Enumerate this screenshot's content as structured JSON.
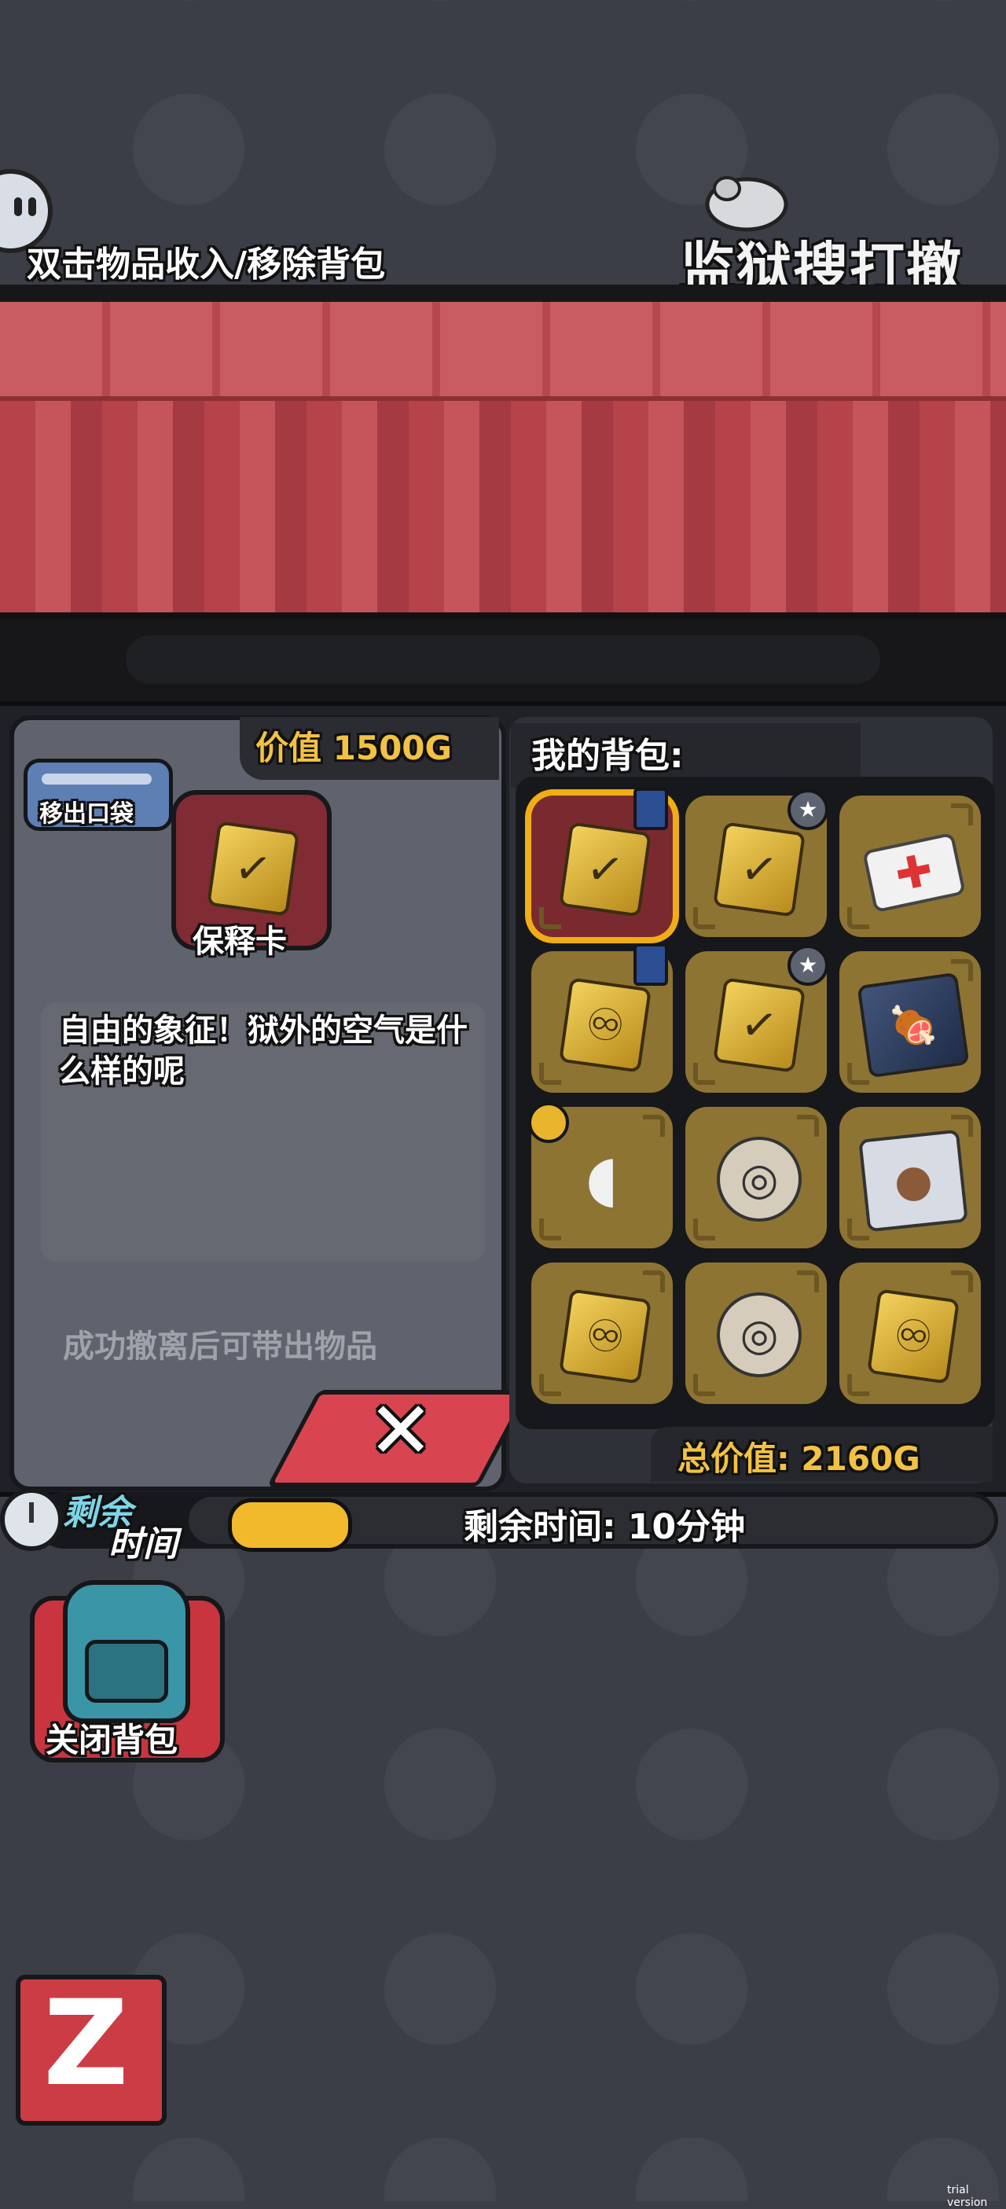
{
  "header": {
    "hint": "双击物品收入/移除背包",
    "logo_text": "监狱搜打撤"
  },
  "detail": {
    "value_label": "价值 1500G",
    "remove_pocket_label": "移出口袋",
    "item_name": "保释卡",
    "description": "自由的象征！狱外的空气是什么样的呢",
    "carry_note": "成功撤离后可带出物品"
  },
  "bag": {
    "title": "我的背包:",
    "total": "总价值: 2160G",
    "slots": [
      {
        "icon": "bail-card-icon",
        "glyph": "✓",
        "selected": true,
        "badge": "pants-icon"
      },
      {
        "icon": "bail-card-icon",
        "glyph": "✓",
        "badge": "star-icon"
      },
      {
        "icon": "medical-card-icon",
        "glyph": "✚"
      },
      {
        "icon": "gold-ribbon-card-icon",
        "glyph": "♾",
        "badge": "pants-icon"
      },
      {
        "icon": "bail-card-icon",
        "glyph": "✓",
        "badge": "star-icon"
      },
      {
        "icon": "steak-package-icon",
        "glyph": "🍖"
      },
      {
        "icon": "earbud-icon",
        "glyph": "◖",
        "badge": "coin-icon"
      },
      {
        "icon": "film-reel-icon",
        "glyph": "◎"
      },
      {
        "icon": "capybara-pack-icon",
        "glyph": "●"
      },
      {
        "icon": "gold-ribbon-card-icon",
        "glyph": "♾"
      },
      {
        "icon": "film-reel-icon",
        "glyph": "◎"
      },
      {
        "icon": "gold-ribbon-card-icon",
        "glyph": "♾"
      }
    ]
  },
  "timer": {
    "label_1": "剩余",
    "label_2": "时间",
    "text": "剩余时间: 10分钟",
    "fill_fraction": 0.15
  },
  "actions": {
    "close_bag": "关闭背包",
    "close_x": "✕",
    "z_button": "Z"
  },
  "footer": {
    "trial": "trial version"
  }
}
